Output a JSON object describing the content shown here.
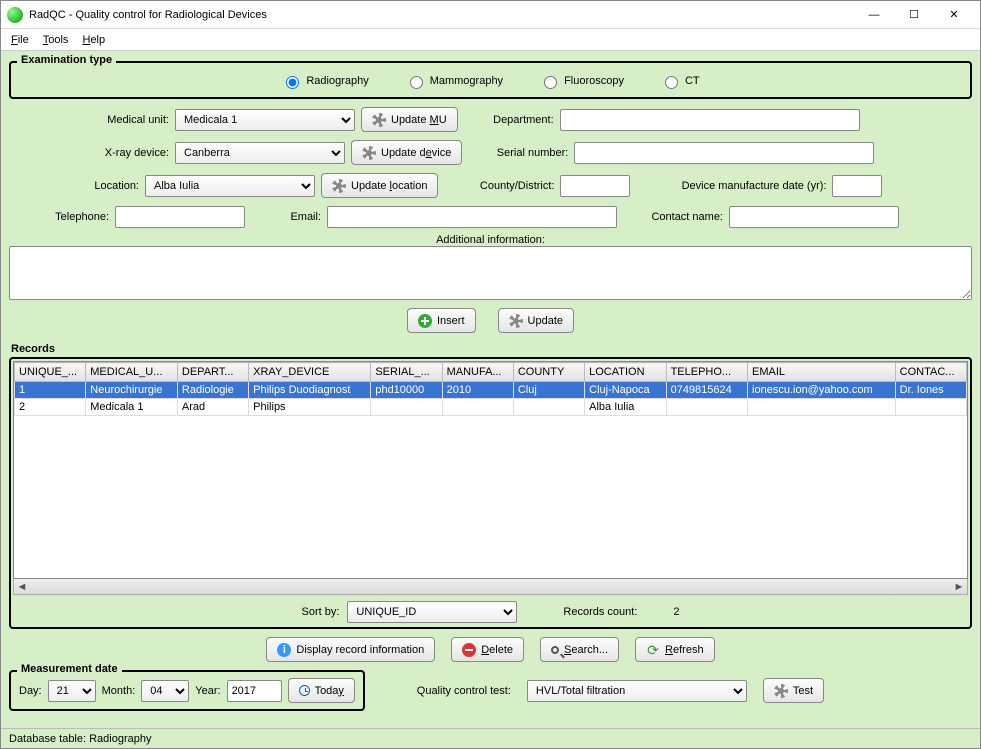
{
  "window": {
    "title": "RadQC - Quality control for Radiological Devices"
  },
  "menu": {
    "file": "File",
    "tools": "Tools",
    "help": "Help"
  },
  "exam": {
    "legend": "Examination type",
    "radiography": "Radiography",
    "mammography": "Mammography",
    "fluoroscopy": "Fluoroscopy",
    "ct": "CT"
  },
  "labels": {
    "medical_unit": "Medical unit:",
    "update_mu": "Update MU",
    "department": "Department:",
    "xray_device": "X-ray device:",
    "update_device": "Update device",
    "serial_number": "Serial number:",
    "location": "Location:",
    "update_location": "Update location",
    "county": "County/District:",
    "manuf_date": "Device manufacture date (yr):",
    "telephone": "Telephone:",
    "email": "Email:",
    "contact_name": "Contact name:",
    "additional_info": "Additional information:",
    "insert": "Insert",
    "update": "Update",
    "records": "Records",
    "sort_by": "Sort by:",
    "records_count": "Records count:",
    "display_info": "Display record information",
    "delete": "Delete",
    "search": "Search...",
    "refresh": "Refresh",
    "measurement_date": "Measurement date",
    "day": "Day:",
    "month": "Month:",
    "year": "Year:",
    "today": "Today",
    "qc_test": "Quality control test:",
    "test": "Test"
  },
  "values": {
    "medical_unit": "Medicala 1",
    "xray_device": "Canberra",
    "location": "Alba Iulia",
    "department": "",
    "serial_number": "",
    "county": "",
    "manuf_date": "",
    "telephone": "",
    "email": "",
    "contact_name": "",
    "additional_info": "",
    "sort_by": "UNIQUE_ID",
    "records_count": "2",
    "day": "21",
    "month": "04",
    "year": "2017",
    "qc_test": "HVL/Total filtration"
  },
  "grid": {
    "headers": [
      "UNIQUE_...",
      "MEDICAL_U...",
      "DEPART...",
      "XRAY_DEVICE",
      "SERIAL_...",
      "MANUFA...",
      "COUNTY",
      "LOCATION",
      "TELEPHO...",
      "EMAIL",
      "CONTAC..."
    ],
    "rows": [
      {
        "selected": true,
        "cells": [
          "1",
          "Neurochirurgie",
          "Radiologie",
          "Philips Duodiagnost",
          "phd10000",
          "2010",
          "Cluj",
          "Cluj-Napoca",
          "0749815624",
          "ionescu.ion@yahoo.com",
          "Dr. Iones"
        ]
      },
      {
        "selected": false,
        "cells": [
          "2",
          "Medicala 1",
          "Arad",
          "Philips",
          "",
          "",
          "",
          "Alba Iulia",
          "",
          "",
          ""
        ]
      }
    ]
  },
  "status": "Database table: Radiography"
}
